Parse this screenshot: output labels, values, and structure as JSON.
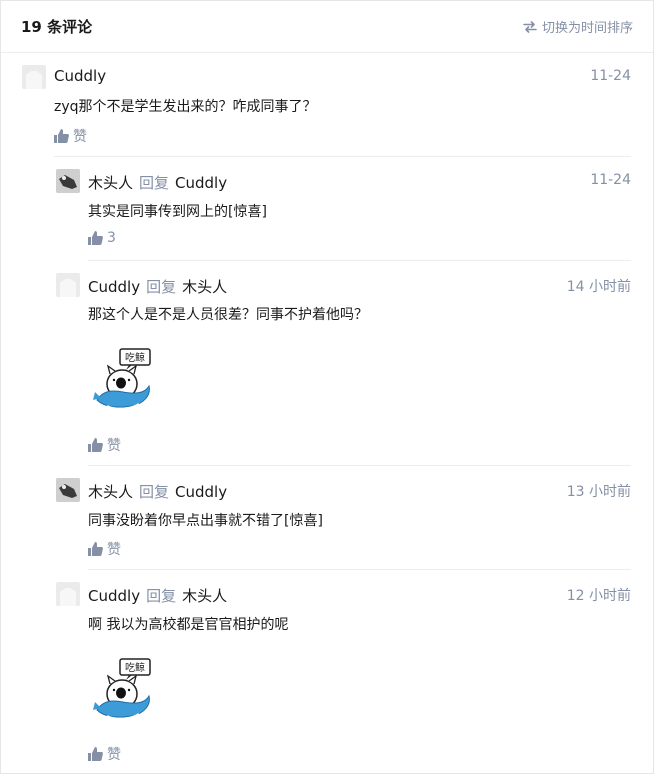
{
  "header": {
    "title": "19 条评论",
    "sort_label": "切换为时间排序"
  },
  "comments": [
    {
      "author": "Cuddly",
      "reply_label": "",
      "reply_to": "",
      "time": "11-24",
      "text": "zyq那个不是学生发出来的？咋成同事了？",
      "like": "赞",
      "avatar": "blank"
    },
    {
      "author": "木头人",
      "reply_label": "回复",
      "reply_to": "Cuddly",
      "time": "11-24",
      "text": "其实是同事传到网上的[惊喜]",
      "like": "3",
      "avatar": "bw"
    },
    {
      "author": "Cuddly",
      "reply_label": "回复",
      "reply_to": "木头人",
      "time": "14 小时前",
      "text": "那这个人是不是人员很差？同事不护着他吗？",
      "like": "赞",
      "avatar": "blank",
      "sticker_text": "吃鲸"
    },
    {
      "author": "木头人",
      "reply_label": "回复",
      "reply_to": "Cuddly",
      "time": "13 小时前",
      "text": "同事没盼着你早点出事就不错了[惊喜]",
      "like": "赞",
      "avatar": "bw"
    },
    {
      "author": "Cuddly",
      "reply_label": "回复",
      "reply_to": "木头人",
      "time": "12 小时前",
      "text": "啊 我以为高校都是官官相护的呢",
      "like": "赞",
      "avatar": "blank",
      "sticker_text": "吃鲸"
    }
  ],
  "colors": {
    "muted": "#8590a6",
    "divider": "#ededed",
    "whale": "#3d9bd8"
  }
}
